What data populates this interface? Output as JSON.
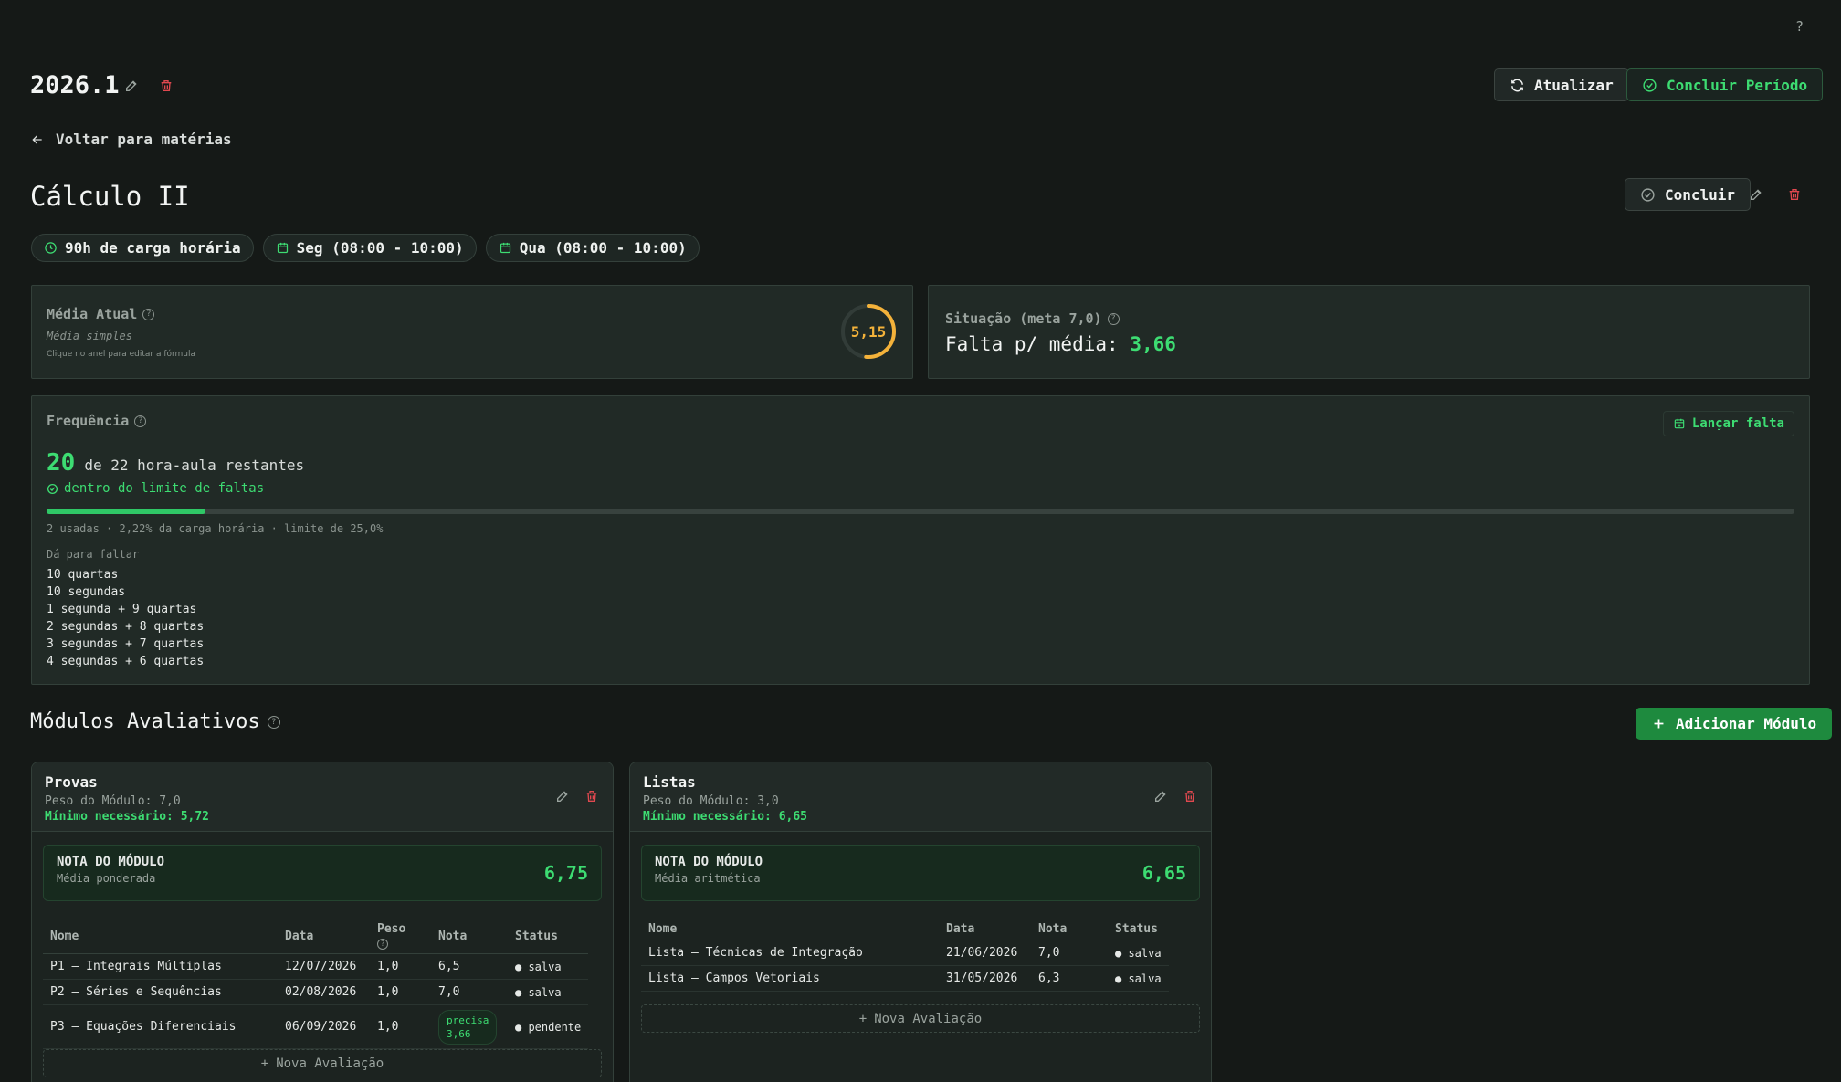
{
  "help": "?",
  "header": {
    "period_title": "2026.1",
    "refresh_label": "Atualizar",
    "conclude_period_label": "Concluir Período"
  },
  "nav": {
    "back_label": "Voltar para matérias"
  },
  "subject": {
    "title": "Cálculo II",
    "conclude_label": "Concluir",
    "chips": [
      {
        "icon": "clock-icon",
        "label": "90h de carga horária"
      },
      {
        "icon": "calendar-icon",
        "label": "Seg (08:00 - 10:00)"
      },
      {
        "icon": "calendar-icon",
        "label": "Qua (08:00 - 10:00)"
      }
    ]
  },
  "average": {
    "label": "Média Atual",
    "formula": "Média simples",
    "hint": "Clique no anel para editar a fórmula",
    "value": "5,15",
    "ring_fraction": 0.515,
    "ring_color": "#f4b23a"
  },
  "situation": {
    "label": "Situação (meta 7,0)",
    "text": "Falta p/ média:",
    "value": "3,66"
  },
  "frequency": {
    "label": "Frequência",
    "add_absence_label": "Lançar falta",
    "remaining": "20",
    "remaining_text": "de 22 hora-aula restantes",
    "status": "dentro do limite de faltas",
    "used_fraction": 0.0909,
    "details": "2 usadas · 2,22% da carga horária · limite de 25,0%",
    "can_miss_label": "Dá para faltar",
    "options": [
      "10 quartas",
      "10 segundas",
      "1 segunda + 9 quartas",
      "2 segundas + 8 quartas",
      "3 segundas + 7 quartas",
      "4 segundas + 6 quartas"
    ]
  },
  "modules": {
    "title": "Módulos Avaliativos",
    "add_label": "Adicionar Módulo",
    "new_eval_label": "Nova Avaliação",
    "note_label": "NOTA DO MÓDULO",
    "items": [
      {
        "name": "Provas",
        "weight": "Peso do Módulo: 7,0",
        "minimum": "Mínimo necessário: 5,72",
        "note_method": "Média ponderada",
        "note_value": "6,75",
        "headers": [
          "Nome",
          "Data",
          "Peso",
          "Nota",
          "Status"
        ],
        "rows": [
          {
            "name": "P1 — Integrais Múltiplas",
            "date": "12/07/2026",
            "weight": "1,0",
            "grade": "6,5",
            "status": "● salva"
          },
          {
            "name": "P2 — Séries e Sequências",
            "date": "02/08/2026",
            "weight": "1,0",
            "grade": "7,0",
            "status": "● salva"
          },
          {
            "name": "P3 — Equações Diferenciais",
            "date": "06/09/2026",
            "weight": "1,0",
            "grade": "precisa 3,66",
            "status": "● pendente"
          }
        ]
      },
      {
        "name": "Listas",
        "weight": "Peso do Módulo: 3,0",
        "minimum": "Mínimo necessário: 6,65",
        "note_method": "Média aritmética",
        "note_value": "6,65",
        "headers": [
          "Nome",
          "Data",
          "Nota",
          "Status"
        ],
        "rows": [
          {
            "name": "Lista — Técnicas de Integração",
            "date": "21/06/2026",
            "grade": "7,0",
            "status": "● salva"
          },
          {
            "name": "Lista — Campos Vetoriais",
            "date": "31/05/2026",
            "grade": "6,3",
            "status": "● salva"
          }
        ]
      }
    ]
  }
}
